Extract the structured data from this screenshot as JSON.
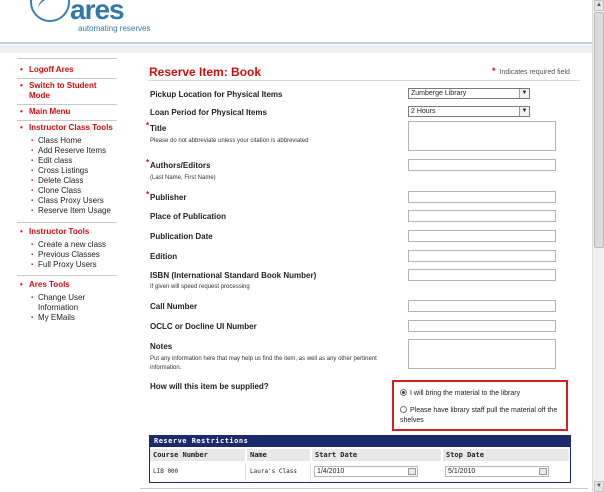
{
  "header": {
    "logo_text": "ares",
    "tagline": "automating reserves"
  },
  "sidebar": {
    "logoff": "Logoff Ares",
    "switch_student": "Switch to Student Mode",
    "main_menu": "Main Menu",
    "instructor_class_tools": {
      "heading": "Instructor Class Tools",
      "items": [
        "Class Home",
        "Add Reserve Items",
        "Edit class",
        "Cross Listings",
        "Delete Class",
        "Clone Class",
        "Class Proxy Users",
        "Reserve Item Usage"
      ]
    },
    "instructor_tools": {
      "heading": "Instructor Tools",
      "items": [
        "Create a new class",
        "Previous Classes",
        "Full Proxy Users"
      ]
    },
    "ares_tools": {
      "heading": "Ares Tools",
      "items": [
        "Change User Information",
        "My EMails"
      ]
    }
  },
  "form": {
    "title": "Reserve Item: Book",
    "required_note": "Indicates required field",
    "required_star": "*",
    "pickup_label": "Pickup Location for Physical Items",
    "pickup_value": "Zumberge Library",
    "loan_label": "Loan Period for Physical Items",
    "loan_value": "2 Hours",
    "title_label": "Title",
    "title_hint": "Please do not abbreviate unless your citation is abbreviated",
    "authors_label": "Authors/Editors",
    "authors_hint": "(Last Name, First Name)",
    "publisher_label": "Publisher",
    "place_label": "Place of Publication",
    "pubdate_label": "Publication Date",
    "edition_label": "Edition",
    "isbn_label": "ISBN (International Standard Book Number)",
    "isbn_hint": "If given will speed request processing",
    "callnumber_label": "Call Number",
    "oclc_label": "OCLC or Docline UI Number",
    "notes_label": "Notes",
    "notes_hint": "Put any information here that may help us find the item, as well as any other pertinent information.",
    "supply_label": "How will this item be supplied?",
    "supply_option_1": "I will bring the material to the library",
    "supply_option_2": "Please have library staff pull the material off the shelves"
  },
  "restrictions": {
    "title": "Reserve Restrictions",
    "columns": [
      "Course Number",
      "Name",
      "Start Date",
      "Stop Date"
    ],
    "row": {
      "course": "LIB 000",
      "name": "Laura's Class",
      "start": "1/4/2010",
      "stop": "5/1/2010"
    }
  },
  "colors": {
    "accent_red": "#cc1111",
    "brand_blue": "#3377aa",
    "table_header_navy": "#1a2a6a"
  }
}
